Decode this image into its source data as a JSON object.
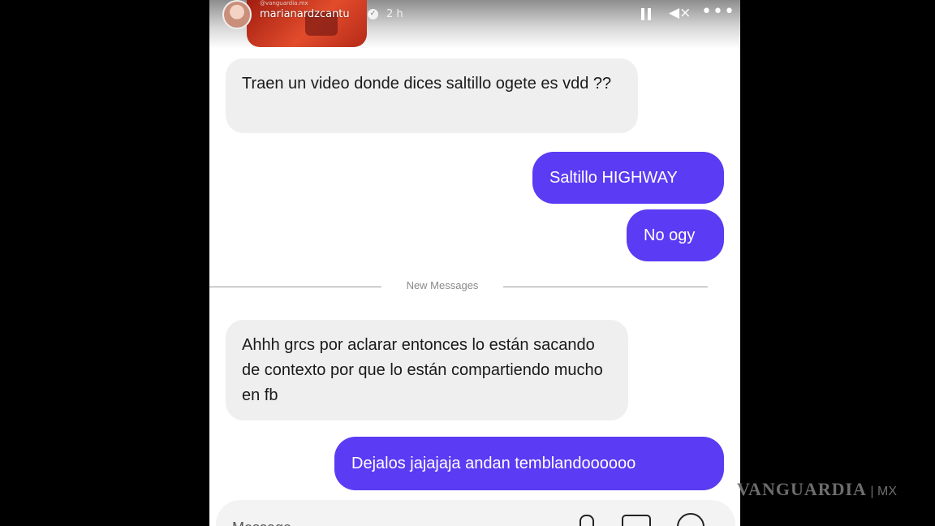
{
  "story": {
    "username_sub": "@vanguardia.mx",
    "username": "marianardzcantu",
    "timestamp": "2 h",
    "icons": {
      "pause": "pause-icon",
      "mute": "speaker-mute-icon",
      "more": "more-dots-icon",
      "verified": "verified-icon"
    }
  },
  "chat": {
    "messages": [
      {
        "from": "them",
        "text": "Traen un video donde dices saltillo ogete es vdd ??"
      },
      {
        "from": "me",
        "text": "Saltillo HIGHWAY"
      },
      {
        "from": "me",
        "text": "No ogy"
      },
      {
        "from": "them",
        "text": "Ahhh grcs por aclarar entonces lo están sacando de contexto por que lo están compartiendo mucho en fb"
      },
      {
        "from": "me",
        "text": "Dejalos jajajaja andan temblandoooooo"
      }
    ],
    "divider_label": "New Messages",
    "composer_placeholder": "Message...",
    "colors": {
      "outgoing": "#5b3bf3",
      "incoming": "#efefef"
    }
  },
  "watermark": {
    "text": "VANGUARDIA",
    "suffix": "MX"
  }
}
